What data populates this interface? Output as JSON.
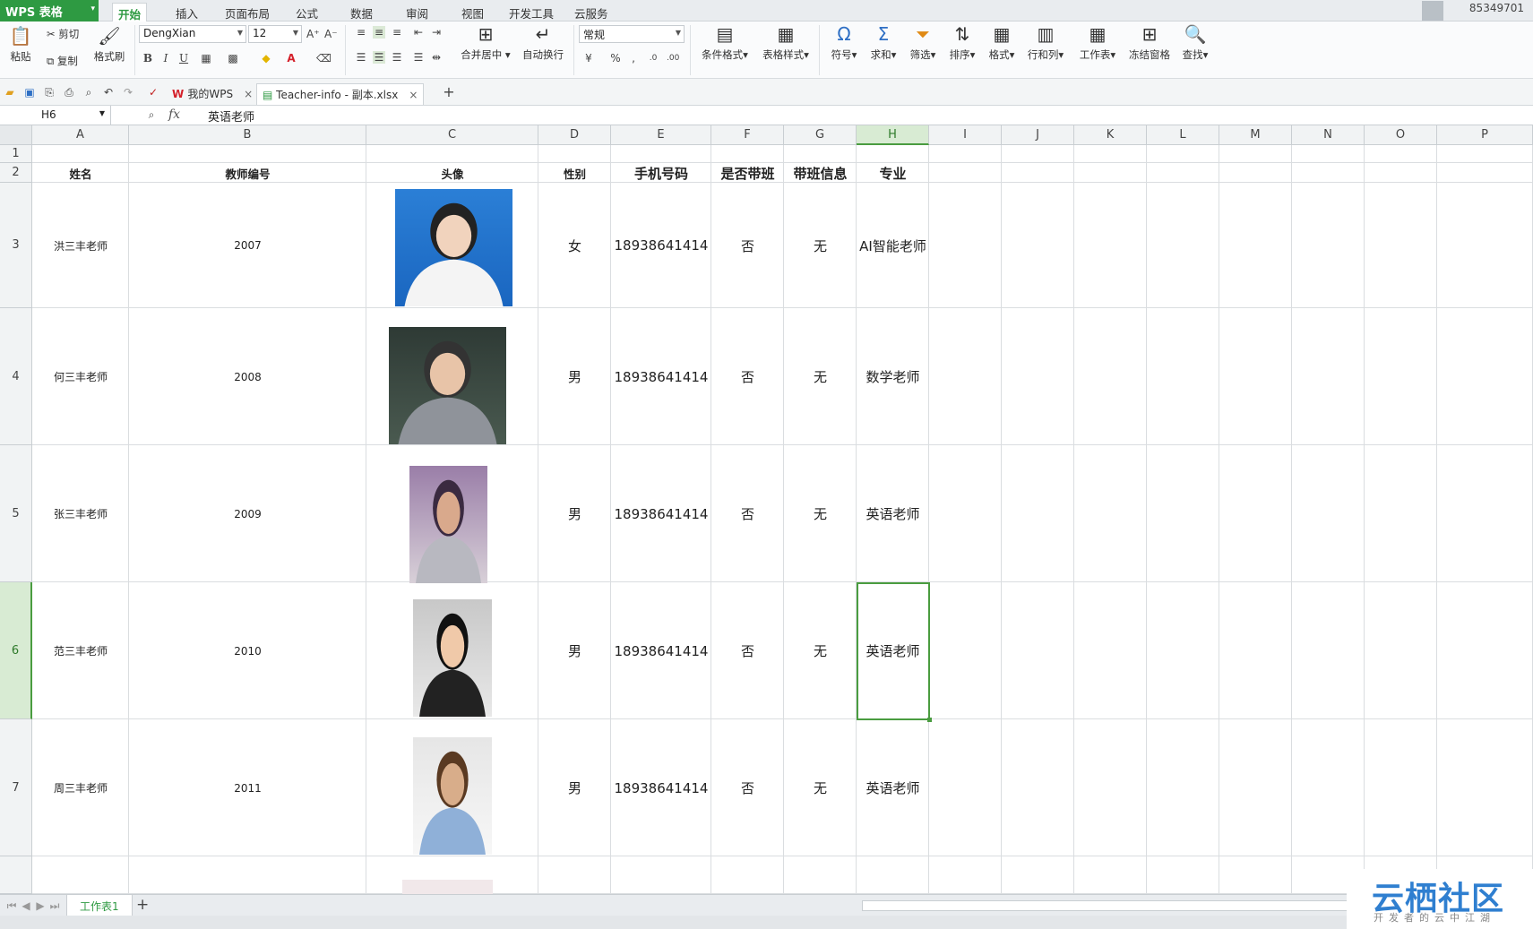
{
  "app": {
    "name": "WPS 表格",
    "user": "85349701"
  },
  "menu_tabs": [
    "开始",
    "插入",
    "页面布局",
    "公式",
    "数据",
    "审阅",
    "视图",
    "开发工具",
    "云服务"
  ],
  "ribbon": {
    "paste": "粘贴",
    "cut": "剪切",
    "copy": "复制",
    "format_painter": "格式刷",
    "font": "DengXian",
    "font_size": "12",
    "bold": "B",
    "italic": "I",
    "underline": "U",
    "merge_center": "合并居中",
    "wrap": "自动换行",
    "number_format": "常规",
    "percent": "%",
    "cond_format": "条件格式",
    "table_style": "表格样式",
    "symbol": "符号",
    "sum": "求和",
    "filter": "筛选",
    "sort": "排序",
    "format": "格式",
    "row_col": "行和列",
    "worksheet": "工作表",
    "freeze": "冻结窗格",
    "find": "查找"
  },
  "doc_tabs": [
    {
      "label": "我的WPS"
    },
    {
      "label": "Teacher-info - 副本.xlsx"
    }
  ],
  "formula_bar": {
    "name_box": "H6",
    "fx": "fx",
    "value": "英语老师"
  },
  "columns": [
    "A",
    "B",
    "C",
    "D",
    "E",
    "F",
    "G",
    "H",
    "I",
    "J",
    "K",
    "L",
    "M",
    "N",
    "O",
    "P"
  ],
  "header_row": {
    "A": "姓名",
    "B": "教师编号",
    "C": "头像",
    "D": "性别",
    "E": "手机号码",
    "F": "是否带班",
    "G": "带班信息",
    "H": "专业"
  },
  "rows": [
    {
      "num": "3",
      "name": "洪三丰老师",
      "id": "2007",
      "gender": "女",
      "phone": "18938641414",
      "class": "否",
      "class_info": "无",
      "major": "AI智能老师"
    },
    {
      "num": "4",
      "name": "何三丰老师",
      "id": "2008",
      "gender": "男",
      "phone": "18938641414",
      "class": "否",
      "class_info": "无",
      "major": "数学老师"
    },
    {
      "num": "5",
      "name": "张三丰老师",
      "id": "2009",
      "gender": "男",
      "phone": "18938641414",
      "class": "否",
      "class_info": "无",
      "major": "英语老师"
    },
    {
      "num": "6",
      "name": "范三丰老师",
      "id": "2010",
      "gender": "男",
      "phone": "18938641414",
      "class": "否",
      "class_info": "无",
      "major": "英语老师"
    },
    {
      "num": "7",
      "name": "周三丰老师",
      "id": "2011",
      "gender": "男",
      "phone": "18938641414",
      "class": "否",
      "class_info": "无",
      "major": "英语老师"
    }
  ],
  "row_numbers": {
    "r1": "1",
    "r2": "2"
  },
  "sheet_tab": "工作表1",
  "watermark": {
    "title": "云栖社区",
    "subtitle": "开发者的云中江湖"
  },
  "colors": {
    "accent": "#2e9a42",
    "selection": "#4a9c40"
  }
}
